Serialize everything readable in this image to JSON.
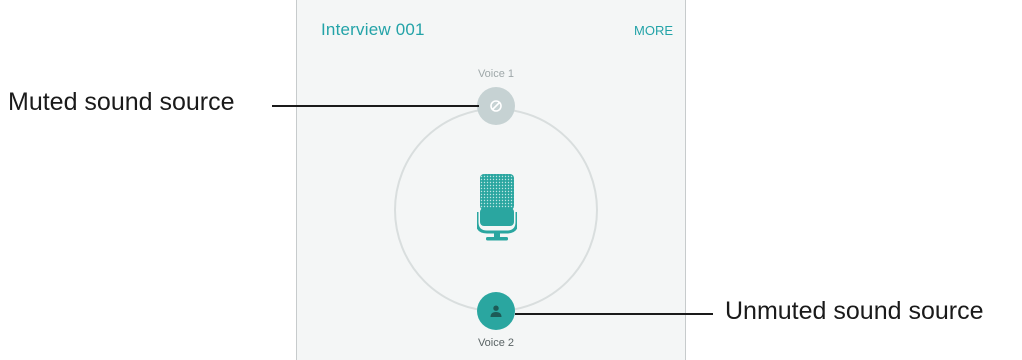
{
  "app": {
    "title": "Interview 001",
    "more_label": "MORE"
  },
  "sources": {
    "voice1": {
      "label": "Voice 1",
      "state": "muted",
      "icon": "mute-icon"
    },
    "voice2": {
      "label": "Voice 2",
      "state": "unmuted",
      "icon": "person-icon"
    }
  },
  "center": {
    "icon": "microphone-icon"
  },
  "callouts": {
    "muted": "Muted sound source",
    "unmuted": "Unmuted sound source"
  },
  "colors": {
    "accent": "#23a3a8",
    "muted_button": "#c6d2d3",
    "unmuted_button": "#2aa6a0",
    "background": "#f4f6f6"
  }
}
